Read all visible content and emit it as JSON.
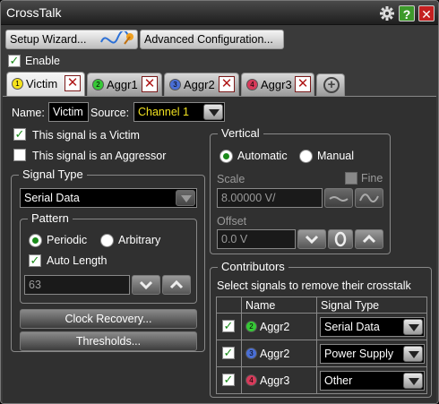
{
  "window": {
    "title": "CrossTalk"
  },
  "toolbar": {
    "setup_wizard_label": "Setup Wizard...",
    "advanced_config_label": "Advanced Configuration...",
    "enable_label": "Enable"
  },
  "tabs": [
    {
      "label": "Victim",
      "marker": "1",
      "color": "#f5e21a",
      "active": true
    },
    {
      "label": "Aggr1",
      "marker": "2",
      "color": "#36c936"
    },
    {
      "label": "Aggr2",
      "marker": "3",
      "color": "#4a6fd6"
    },
    {
      "label": "Aggr3",
      "marker": "4",
      "color": "#d83a5a"
    }
  ],
  "victim": {
    "name_label": "Name:",
    "name_value": "Victim",
    "source_label": "Source:",
    "source_value": "Channel 1",
    "is_victim_label": "This signal is a Victim",
    "is_aggressor_label": "This signal is an Aggressor"
  },
  "signal_type": {
    "title": "Signal Type",
    "value": "Serial Data",
    "pattern": {
      "title": "Pattern",
      "periodic_label": "Periodic",
      "arbitrary_label": "Arbitrary",
      "auto_length_label": "Auto Length",
      "length_value": "63"
    },
    "clock_recovery_label": "Clock Recovery...",
    "thresholds_label": "Thresholds..."
  },
  "vertical": {
    "title": "Vertical",
    "automatic_label": "Automatic",
    "manual_label": "Manual",
    "scale_label": "Scale",
    "scale_value": "8.00000 V/",
    "fine_label": "Fine",
    "offset_label": "Offset",
    "offset_value": "0.0 V"
  },
  "contributors": {
    "title": "Contributors",
    "instruction": "Select signals to remove their crosstalk",
    "headers": {
      "name": "Name",
      "signal_type": "Signal Type"
    },
    "rows": [
      {
        "name": "Aggr2",
        "marker": "2",
        "color": "#36c936",
        "type": "Serial Data"
      },
      {
        "name": "Aggr2",
        "marker": "3",
        "color": "#4a6fd6",
        "type": "Power Supply"
      },
      {
        "name": "Aggr3",
        "marker": "4",
        "color": "#d83a5a",
        "type": "Other"
      }
    ]
  }
}
